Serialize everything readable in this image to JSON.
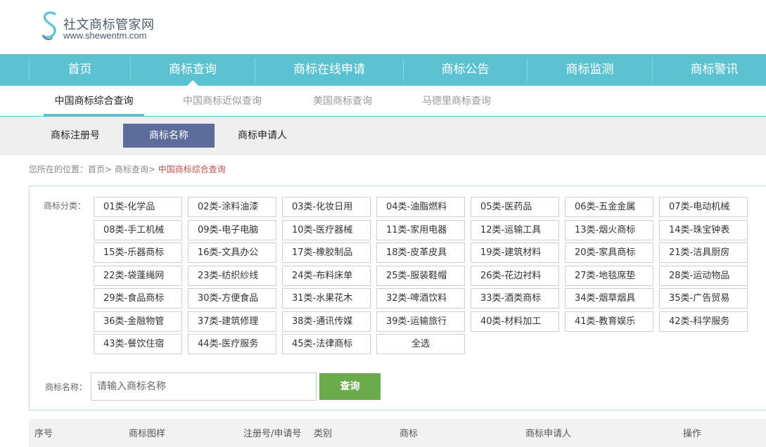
{
  "logo": {
    "name_cn": "社文商标管家网",
    "url": "www.shewentm.com",
    "color": "#5bc2d2"
  },
  "main_nav": {
    "items": [
      {
        "label": "首页"
      },
      {
        "label": "商标查询",
        "active": true
      },
      {
        "label": "商标在线申请"
      },
      {
        "label": "商标公告"
      },
      {
        "label": "商标监测"
      },
      {
        "label": "商标警讯"
      }
    ]
  },
  "sub_tabs": {
    "items": [
      {
        "label": "中国商标综合查询",
        "active": true
      },
      {
        "label": "中国商标近似查询"
      },
      {
        "label": "美国商标查询"
      },
      {
        "label": "马德里商标查询"
      }
    ]
  },
  "search_type": {
    "items": [
      {
        "label": "商标注册号"
      },
      {
        "label": "商标名称",
        "active": true
      },
      {
        "label": "商标申请人"
      }
    ]
  },
  "breadcrumb": {
    "prefix": "您所在的位置：首页> 商标查询> ",
    "current": "中国商标综合查询"
  },
  "filters": {
    "category_label": "商标分类：",
    "classes": [
      "01类-化学品",
      "02类-涂料油漆",
      "03类-化妆日用",
      "04类-油脂燃料",
      "05类-医药品",
      "06类-五金金属",
      "07类-电动机械",
      "08类-手工机械",
      "09类-电子电脑",
      "10类-医疗器械",
      "11类-家用电器",
      "12类-运输工具",
      "13类-烟火商标",
      "14类-珠宝钟表",
      "15类-乐器商标",
      "16类-文具办公",
      "17类-橡胶制品",
      "18类-皮革皮具",
      "19类-建筑材料",
      "20类-家具商标",
      "21类-洁具厨房",
      "22类-袋蓬绳网",
      "23类-纺织纱线",
      "24类-布料床单",
      "25类-服装鞋帽",
      "26类-花边衬料",
      "27类-地毯席垫",
      "28类-运动物品",
      "29类-食品商标",
      "30类-方便食品",
      "31类-水果花木",
      "32类-啤酒饮料",
      "33类-酒类商标",
      "34类-烟草烟具",
      "35类-广告贸易",
      "36类-金融物管",
      "37类-建筑修理",
      "38类-通讯传媒",
      "39类-运输旅行",
      "40类-材料加工",
      "41类-教育娱乐",
      "42类-科学服务",
      "43类-餐饮住宿",
      "44类-医疗服务",
      "45类-法律商标"
    ],
    "select_all": "全选",
    "name_label": "商标名称：",
    "name_placeholder": "请输入商标名称",
    "query_button": "查询",
    "query_button_color": "#6aac4c"
  },
  "table": {
    "headers": [
      "序号",
      "商标图样",
      "注册号/申请号",
      "类别",
      "商标",
      "商标申请人",
      "操作"
    ]
  }
}
